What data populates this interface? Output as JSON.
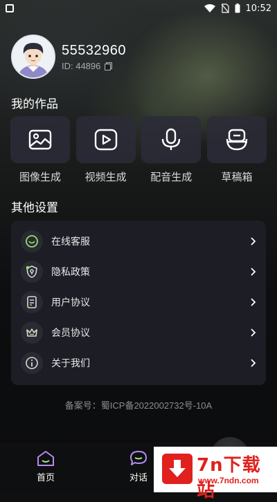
{
  "status_bar": {
    "time": "10:52"
  },
  "profile": {
    "username": "55532960",
    "id_text": "ID: 44896"
  },
  "works": {
    "title": "我的作品",
    "items": [
      {
        "label": "图像生成",
        "icon": "image-icon"
      },
      {
        "label": "视频生成",
        "icon": "video-play-icon"
      },
      {
        "label": "配音生成",
        "icon": "microphone-icon"
      },
      {
        "label": "草稿箱",
        "icon": "drafts-box-icon"
      }
    ]
  },
  "settings": {
    "title": "其他设置",
    "items": [
      {
        "label": "在线客服",
        "icon": "customer-service-icon"
      },
      {
        "label": "隐私政策",
        "icon": "privacy-shield-icon"
      },
      {
        "label": "用户协议",
        "icon": "document-icon"
      },
      {
        "label": "会员协议",
        "icon": "crown-icon"
      },
      {
        "label": "关于我们",
        "icon": "info-icon"
      }
    ]
  },
  "footer": {
    "icp": "备案号：蜀ICP备2022002732号-10A"
  },
  "tabbar": {
    "home": "首页",
    "chat": "对话"
  },
  "watermark": {
    "title": "7n下载站",
    "url": "www.7ndn.com"
  },
  "colors": {
    "accent_green": "#8fe36a",
    "card": "#1d1d25",
    "watermark_red": "#e0211d"
  }
}
